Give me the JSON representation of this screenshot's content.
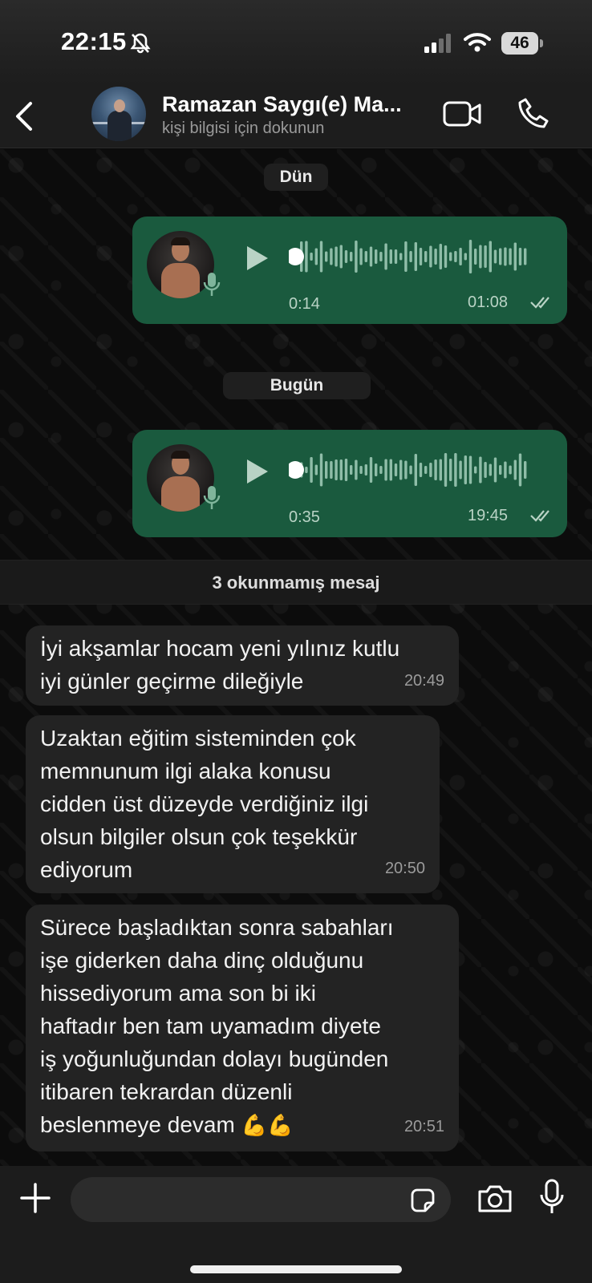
{
  "status_bar": {
    "time": "22:15",
    "battery": "46"
  },
  "header": {
    "contact_name": "Ramazan Saygı(e) Ma...",
    "subtitle": "kişi bilgisi için dokunun"
  },
  "chat": {
    "date_yesterday": "Dün",
    "date_today": "Bugün",
    "voice_messages": [
      {
        "duration": "0:14",
        "time": "01:08",
        "status": "read"
      },
      {
        "duration": "0:35",
        "time": "19:45",
        "status": "read"
      }
    ],
    "unread_banner": "3 okunmamış mesaj",
    "messages": [
      {
        "text": "İyi akşamlar hocam yeni yılınız kutlu\niyi günler geçirme dileğiyle",
        "time": "20:49"
      },
      {
        "text": "Uzaktan eğitim sisteminden çok\nmemnunum ilgi alaka konusu\ncidden üst düzeyde verdiğiniz ilgi\nolsun bilgiler olsun çok teşekkür\nediyorum",
        "time": "20:50"
      },
      {
        "text": "Sürece başladıktan sonra sabahları\nişe giderken daha dinç olduğunu\nhissediyorum ama son bi iki\nhaftadır ben tam uyamadım diyete\niş yoğunluğundan dolayı bugünden\nitibaren tekrardan düzenli\nbeslenmeye devam",
        "emoji": "💪💪",
        "time": "20:51"
      }
    ]
  },
  "input": {
    "placeholder": ""
  },
  "colors": {
    "outgoing_bubble": "#1a5a3e",
    "incoming_bubble": "#232323",
    "background": "#0c0c0c"
  }
}
